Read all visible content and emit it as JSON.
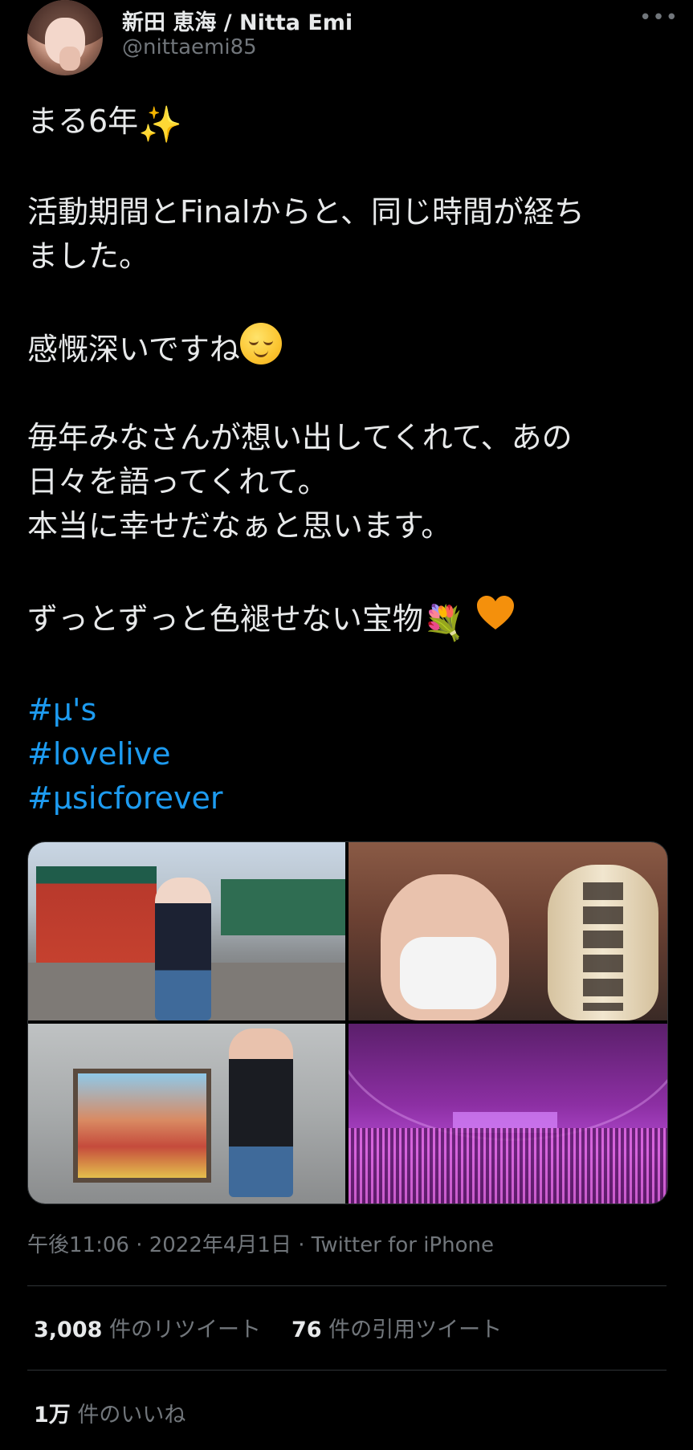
{
  "author": {
    "display_name": "新田 恵海 / Nitta Emi",
    "handle": "@nittaemi85",
    "more_label": "•••"
  },
  "tweet": {
    "line1_text": "まる6年",
    "line1_emoji": "sparkles",
    "line2": "活動期間とFinalからと、同じ時間が経ち",
    "line3": "ました。",
    "line4_text": "感慨深いですね",
    "line4_emoji": "relieved-face",
    "line5": "毎年みなさんが想い出してくれて、あの",
    "line6": "日々を語ってくれて。",
    "line7": "本当に幸せだなぁと思います。",
    "line8_text": "ずっとずっと色褪せない宝物",
    "line8_emoji_1": "bouquet",
    "line8_emoji_2": "orange-heart",
    "hashtags": [
      "#μ's",
      "#lovelive",
      "#μsicforever"
    ]
  },
  "media": {
    "count": 4,
    "items": [
      "photo-shrine-gate",
      "photo-selfie-lantern",
      "photo-painting",
      "photo-dome-concert"
    ]
  },
  "meta": {
    "timestamp": "午後11:06 · 2022年4月1日 · Twitter for iPhone"
  },
  "stats": {
    "retweets_count": "3,008",
    "retweets_label": " 件のリツイート",
    "quotes_count": "76",
    "quotes_label": " 件の引用ツイート",
    "likes_count": "1万",
    "likes_label": " 件のいいね"
  },
  "colors": {
    "background": "#000000",
    "text": "#e7e9ea",
    "secondary": "#71767b",
    "link": "#1d9bf0",
    "divider": "#2f3336",
    "heart": "#f4900c"
  }
}
